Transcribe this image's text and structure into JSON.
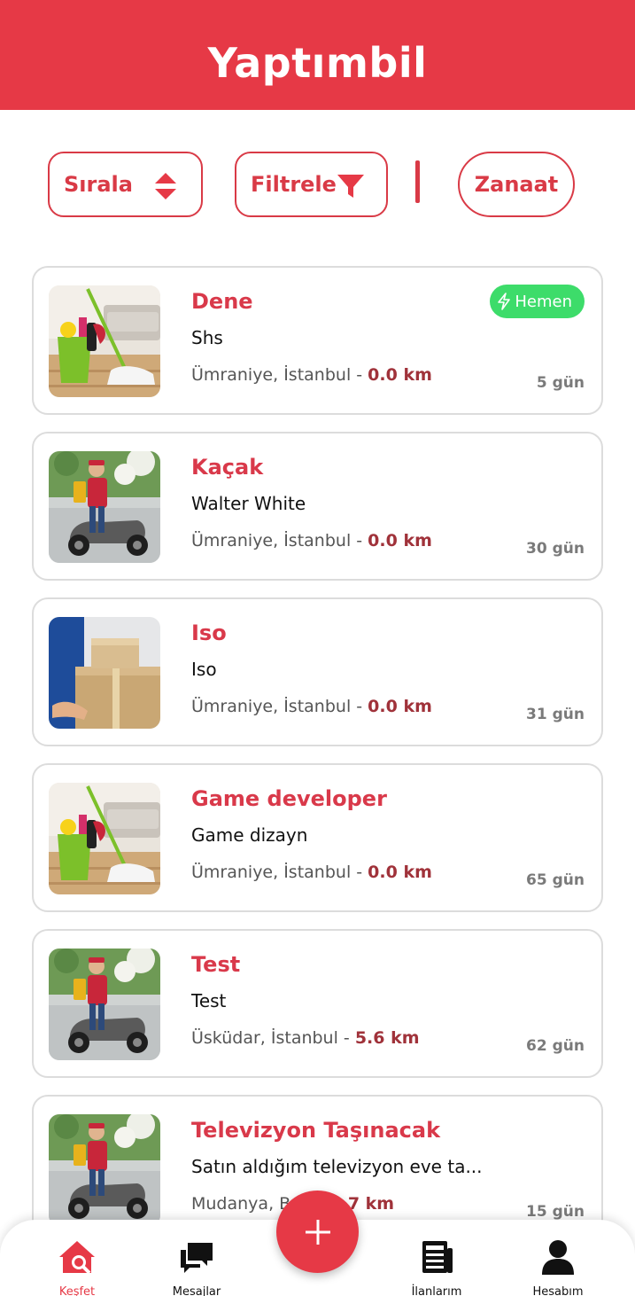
{
  "app": {
    "title": "Yaptımbil"
  },
  "toolbar": {
    "sort_label": "Sırala",
    "filter_label": "Filtrele",
    "craft_label": "Zanaat"
  },
  "listings": [
    {
      "title": "Dene",
      "subtitle": "Shs",
      "location": "Ümraniye, İstanbul",
      "distance": "0.0 km",
      "age": "5 gün",
      "badge": "Hemen",
      "image": "cleaning-photo"
    },
    {
      "title": "Kaçak",
      "subtitle": "Walter White",
      "location": "Ümraniye, İstanbul",
      "distance": "0.0 km",
      "age": "30 gün",
      "image": "courier-photo"
    },
    {
      "title": "Iso",
      "subtitle": "Iso",
      "location": "Ümraniye, İstanbul",
      "distance": "0.0 km",
      "age": "31 gün",
      "image": "boxes-photo"
    },
    {
      "title": "Game developer",
      "subtitle": "Game dizayn",
      "location": "Ümraniye, İstanbul",
      "distance": "0.0 km",
      "age": "65 gün",
      "image": "cleaning-photo"
    },
    {
      "title": "Test",
      "subtitle": "Test",
      "location": "Üsküdar, İstanbul",
      "distance": "5.6 km",
      "age": "62 gün",
      "image": "courier-photo"
    },
    {
      "title": "Televizyon Taşınacak",
      "subtitle": "Satın aldığım televizyon eve ta...",
      "location": "Mudanya, Bu",
      "distance": "73.7 km",
      "age": "15 gün",
      "image": "courier-photo"
    }
  ],
  "nav": {
    "items": [
      {
        "label": "Keşfet",
        "icon": "home-search-icon",
        "active": true
      },
      {
        "label": "Mesajlar",
        "icon": "chat-icon"
      },
      {
        "label": "İlanlarım",
        "icon": "newspaper-icon"
      },
      {
        "label": "Hesabım",
        "icon": "user-icon"
      }
    ],
    "fab_icon": "plus-icon"
  },
  "colors": {
    "brand": "#e63946",
    "badge": "#3ddc6a",
    "distance": "#a0323a"
  }
}
